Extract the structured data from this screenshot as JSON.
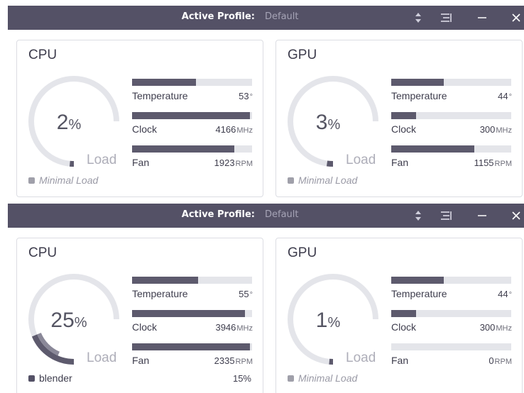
{
  "colors": {
    "titlebar": "#545166",
    "bar_fill": "#5d5a6d",
    "bar_track": "#e4e5ea",
    "gauge_track": "#e4e5ea"
  },
  "windows": [
    {
      "title_label": "Active Profile:",
      "profile": "Default",
      "icons": [
        "sort-arrows-icon",
        "menu-icon",
        "minimize-icon",
        "close-icon"
      ],
      "cpu": {
        "title": "CPU",
        "load_value": "2",
        "load_pct": "%",
        "load_label": "Load",
        "load_fraction": 0.02,
        "status_text": "Minimal Load",
        "status_pct": "",
        "temperature": {
          "label": "Temperature",
          "value": "53",
          "unit": "°",
          "fill": 0.53
        },
        "clock": {
          "label": "Clock",
          "value": "4166",
          "unit": "MHz",
          "fill": 0.98
        },
        "fan": {
          "label": "Fan",
          "value": "1923",
          "unit": "RPM",
          "fill": 0.85
        }
      },
      "gpu": {
        "title": "GPU",
        "load_value": "3",
        "load_pct": "%",
        "load_label": "Load",
        "load_fraction": 0.03,
        "status_text": "Minimal Load",
        "status_pct": "",
        "temperature": {
          "label": "Temperature",
          "value": "44",
          "unit": "°",
          "fill": 0.44
        },
        "clock": {
          "label": "Clock",
          "value": "300",
          "unit": "MHz",
          "fill": 0.21
        },
        "fan": {
          "label": "Fan",
          "value": "1155",
          "unit": "RPM",
          "fill": 0.69
        }
      }
    },
    {
      "title_label": "Active Profile:",
      "profile": "Default",
      "icons": [
        "sort-arrows-icon",
        "menu-icon",
        "minimize-icon",
        "close-icon"
      ],
      "cpu": {
        "title": "CPU",
        "load_value": "25",
        "load_pct": "%",
        "load_label": "Load",
        "load_fraction": 0.25,
        "status_text": "blender",
        "status_pct": "15%",
        "temperature": {
          "label": "Temperature",
          "value": "55",
          "unit": "°",
          "fill": 0.55
        },
        "clock": {
          "label": "Clock",
          "value": "3946",
          "unit": "MHz",
          "fill": 0.94
        },
        "fan": {
          "label": "Fan",
          "value": "2335",
          "unit": "RPM",
          "fill": 0.98
        }
      },
      "gpu": {
        "title": "GPU",
        "load_value": "1",
        "load_pct": "%",
        "load_label": "Load",
        "load_fraction": 0.01,
        "status_text": "Minimal Load",
        "status_pct": "",
        "temperature": {
          "label": "Temperature",
          "value": "44",
          "unit": "°",
          "fill": 0.44
        },
        "clock": {
          "label": "Clock",
          "value": "300",
          "unit": "MHz",
          "fill": 0.21
        },
        "fan": {
          "label": "Fan",
          "value": "0",
          "unit": "RPM",
          "fill": 0.0
        }
      }
    }
  ]
}
